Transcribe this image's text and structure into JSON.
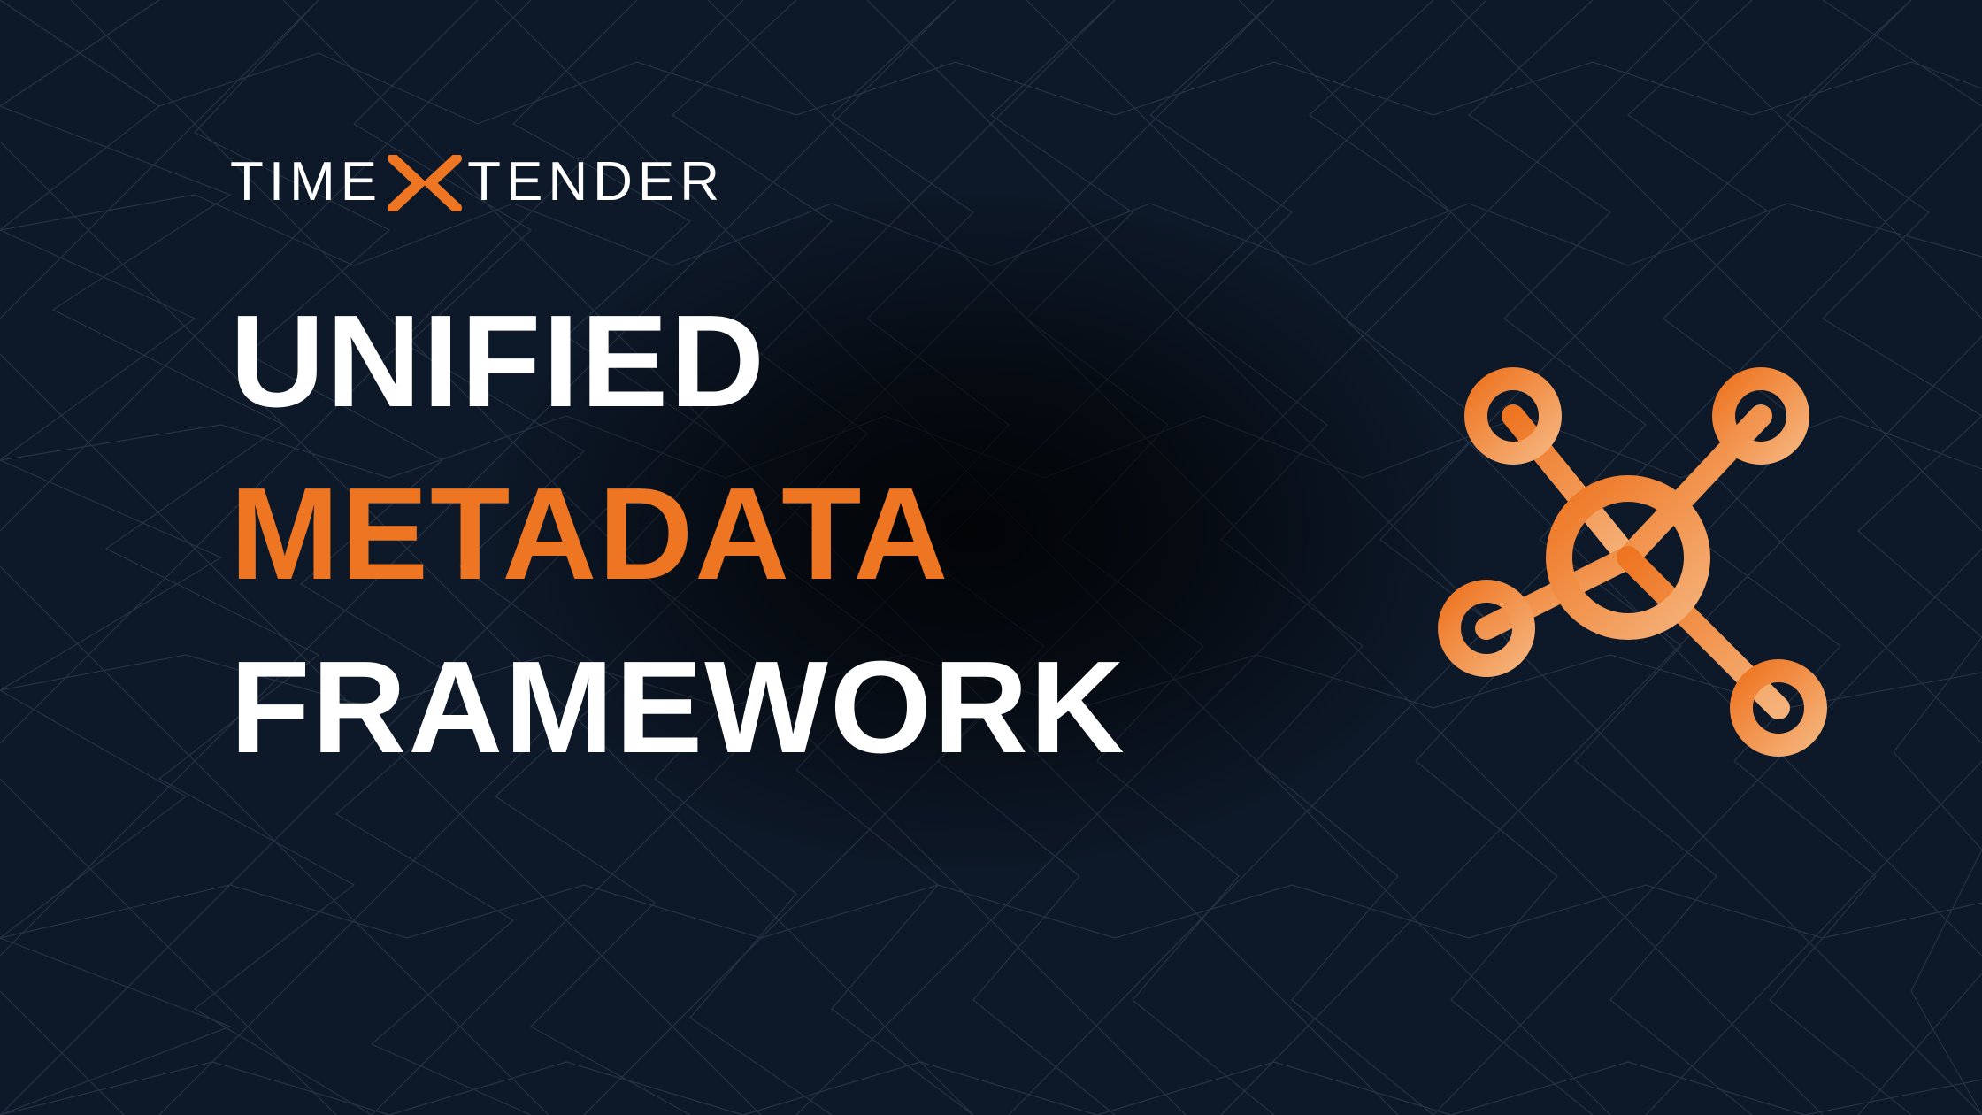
{
  "brand": {
    "left": "TIME",
    "right": "TENDER"
  },
  "headline": {
    "line1": "UNIFIED",
    "line2": "METADATA",
    "line3": "FRAMEWORK"
  },
  "colors": {
    "accent": "#ee7623",
    "accent_light": "#f2a267",
    "bg": "#0d1828",
    "mesh": "#3a4a5e"
  }
}
